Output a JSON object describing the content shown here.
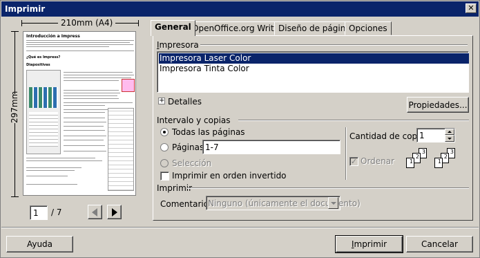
{
  "window": {
    "title": "Imprimir",
    "close_glyph": "✕"
  },
  "preview": {
    "width_label": "210mm (A4)",
    "height_label": "297mm",
    "page_current": "1",
    "page_total": "/ 7",
    "doc_heading": "Introducción a Impress",
    "doc_subheading_1": "¿Qué es Impress?",
    "doc_subheading_2": "Diapositivas"
  },
  "tabs": [
    "General",
    "OpenOffice.org Writer",
    "Diseño de página",
    "Opciones"
  ],
  "printer": {
    "group_label": "Impresora",
    "items": [
      "Impresora Laser Color",
      "Impresora Tinta Color"
    ],
    "selected_index": 0,
    "details_label": "Detalles",
    "properties_button": "Propiedades..."
  },
  "range": {
    "group_label": "Intervalo y copias",
    "all_pages_label": "Todas las páginas",
    "pages_label": "Páginas",
    "pages_value": "1-7",
    "selection_label": "Selección",
    "reverse_label": "Imprimir en orden invertido",
    "selected_option": "all_pages",
    "reverse_checked": false
  },
  "copies": {
    "label": "Cantidad de copias",
    "value": "1",
    "collate_label": "Ordenar",
    "collate_checked": true,
    "collate_enabled": false,
    "stack_numbers": [
      "1",
      "2",
      "3"
    ]
  },
  "print_section": {
    "group_label": "Imprimir",
    "comments_label": "Comentarios",
    "comments_value": "Ninguno (únicamente el documento)"
  },
  "buttons": {
    "help": "Ayuda",
    "print": "Imprimir",
    "cancel": "Cancelar"
  },
  "colors": {
    "title_bar": "#0a246a",
    "selection": "#0a246a",
    "face": "#d4d0c8"
  }
}
